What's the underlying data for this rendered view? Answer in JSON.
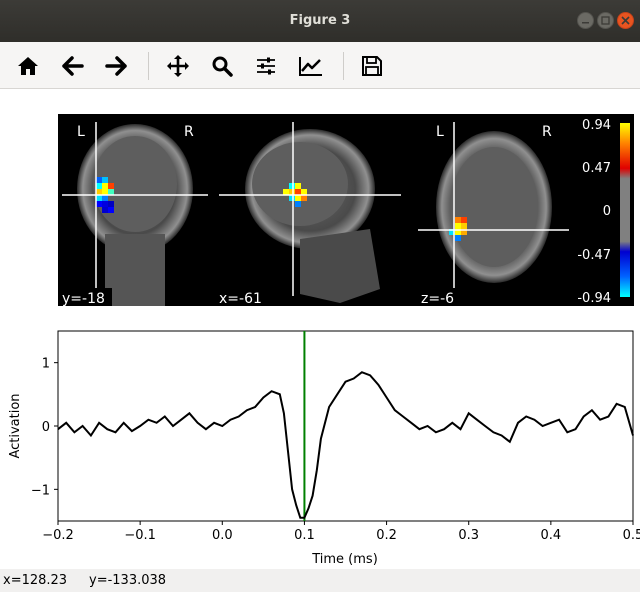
{
  "window": {
    "title": "Figure 3"
  },
  "toolbar": {
    "tools": [
      "home",
      "back",
      "forward",
      "pan",
      "zoom",
      "configure-subplots",
      "edit-axis",
      "save"
    ]
  },
  "brain": {
    "panels": [
      {
        "coord_label": "y=-18",
        "side_left": "L",
        "side_right": "R"
      },
      {
        "coord_label": "x=-61"
      },
      {
        "coord_label": "z=-6",
        "side_left": "L",
        "side_right": "R"
      }
    ],
    "colorbar": {
      "ticks": [
        "0.94",
        "0.47",
        "0",
        "-0.47",
        "-0.94"
      ]
    }
  },
  "chart_data": {
    "type": "line",
    "xlabel": "Time (ms)",
    "ylabel": "Activation",
    "xlim": [
      -0.2,
      0.5
    ],
    "ylim": [
      -1.5,
      1.5
    ],
    "xticks": [
      "−0.2",
      "−0.1",
      "0.0",
      "0.1",
      "0.2",
      "0.3",
      "0.4",
      "0.5"
    ],
    "yticks": [
      "1",
      "0",
      "−1"
    ],
    "vline_x": 0.1,
    "vline_color": "#008000",
    "line_color": "#000000",
    "series": [
      {
        "x": [
          -0.2,
          -0.19,
          -0.18,
          -0.17,
          -0.16,
          -0.15,
          -0.14,
          -0.13,
          -0.12,
          -0.11,
          -0.1,
          -0.09,
          -0.08,
          -0.07,
          -0.06,
          -0.05,
          -0.04,
          -0.03,
          -0.02,
          -0.01,
          0.0,
          0.01,
          0.02,
          0.03,
          0.04,
          0.05,
          0.06,
          0.07,
          0.075,
          0.08,
          0.085,
          0.09,
          0.095,
          0.1,
          0.105,
          0.11,
          0.115,
          0.12,
          0.13,
          0.14,
          0.15,
          0.16,
          0.17,
          0.18,
          0.19,
          0.2,
          0.21,
          0.22,
          0.23,
          0.24,
          0.25,
          0.26,
          0.27,
          0.28,
          0.29,
          0.3,
          0.31,
          0.32,
          0.33,
          0.34,
          0.35,
          0.36,
          0.37,
          0.38,
          0.39,
          0.4,
          0.41,
          0.42,
          0.43,
          0.44,
          0.45,
          0.46,
          0.47,
          0.48,
          0.49,
          0.5
        ],
        "values": [
          -0.05,
          0.05,
          -0.1,
          0.0,
          -0.15,
          0.05,
          -0.05,
          -0.1,
          0.05,
          -0.08,
          0.0,
          0.1,
          0.05,
          0.15,
          0.0,
          0.1,
          0.2,
          0.05,
          -0.05,
          0.05,
          0.0,
          0.1,
          0.15,
          0.25,
          0.3,
          0.45,
          0.55,
          0.5,
          0.2,
          -0.4,
          -1.0,
          -1.25,
          -1.45,
          -1.45,
          -1.3,
          -1.1,
          -0.7,
          -0.2,
          0.3,
          0.5,
          0.7,
          0.75,
          0.85,
          0.8,
          0.65,
          0.45,
          0.25,
          0.15,
          0.05,
          -0.05,
          0.0,
          -0.1,
          -0.05,
          0.05,
          -0.05,
          0.2,
          0.1,
          0.0,
          -0.1,
          -0.15,
          -0.25,
          0.05,
          0.15,
          0.1,
          0.0,
          0.05,
          0.1,
          -0.1,
          -0.05,
          0.15,
          0.25,
          0.1,
          0.15,
          0.35,
          0.3,
          -0.15
        ]
      }
    ]
  },
  "status": {
    "x": "x=128.23",
    "y": "y=-133.038"
  }
}
